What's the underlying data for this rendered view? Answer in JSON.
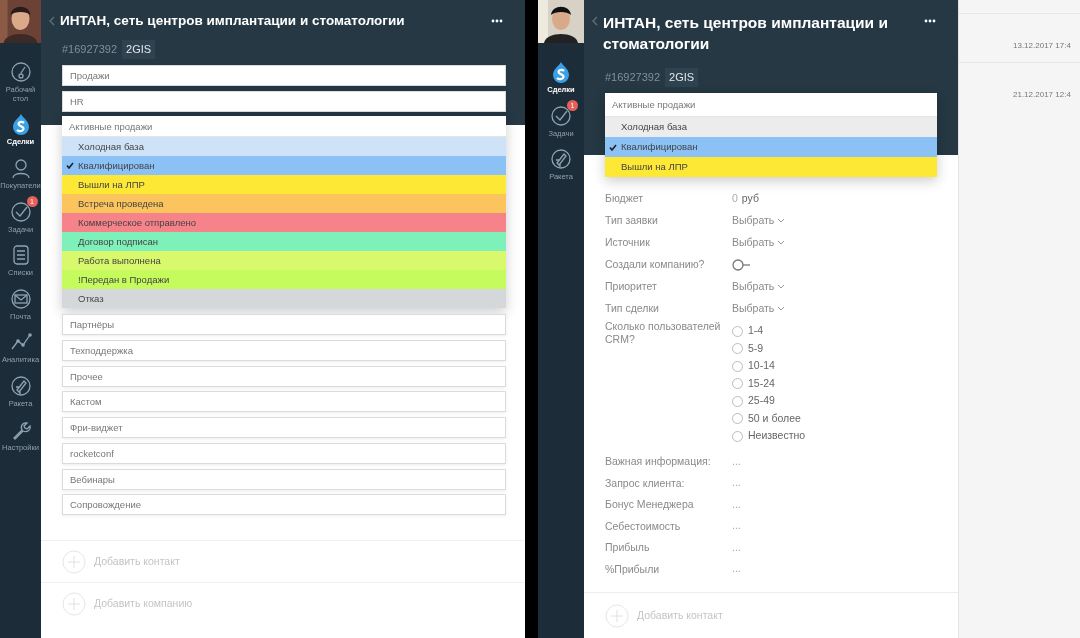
{
  "panels": [
    {
      "sidebar": {
        "items": [
          {
            "kind": "gauge",
            "label": "Рабочий стол",
            "selected": false
          },
          {
            "kind": "deals",
            "label": "Сделки",
            "selected": true
          },
          {
            "kind": "person",
            "label": "Покупатели",
            "selected": false
          },
          {
            "kind": "check",
            "label": "Задачи",
            "selected": false,
            "badge": "1"
          },
          {
            "kind": "list",
            "label": "Списки",
            "selected": false
          },
          {
            "kind": "mail",
            "label": "Почта",
            "selected": false
          },
          {
            "kind": "chart",
            "label": "Аналитика",
            "selected": false
          },
          {
            "kind": "rocket",
            "label": "Ракета",
            "selected": false
          },
          {
            "kind": "wrench",
            "label": "Настройки",
            "selected": false
          }
        ]
      },
      "header": {
        "title": "ИНТАН, сеть центров имплантации и стоматологии",
        "id": "#16927392",
        "tag": "2GIS"
      },
      "pipelines": [
        {
          "label": "Продажи",
          "expanded": false
        },
        {
          "label": "HR",
          "expanded": false
        },
        {
          "label": "Активные продажи",
          "expanded": true,
          "stages": [
            {
              "label": "Холодная база",
              "color": "#cfe3f8",
              "selected": false
            },
            {
              "label": "Квалифицирован",
              "color": "#8bc1f5",
              "selected": true
            },
            {
              "label": "Вышли на ЛПР",
              "color": "#fde835",
              "selected": false
            },
            {
              "label": "Встреча проведена",
              "color": "#fbc45c",
              "selected": false
            },
            {
              "label": "Коммерческое отправлено",
              "color": "#f6828a",
              "selected": false
            },
            {
              "label": "Договор подписан",
              "color": "#7ef0b9",
              "selected": false
            },
            {
              "label": "Работа выполнена",
              "color": "#d7f96b",
              "selected": false
            },
            {
              "label": "!Передан в Продажи",
              "color": "#c6fb5e",
              "selected": false
            },
            {
              "label": "Отказ",
              "color": "#d5d8db",
              "selected": false
            }
          ]
        },
        {
          "label": "Партнёры",
          "expanded": false
        },
        {
          "label": "Техподдержка",
          "expanded": false
        },
        {
          "label": "Прочее",
          "expanded": false
        },
        {
          "label": "Кастом",
          "expanded": false
        },
        {
          "label": "Фри-виджет",
          "expanded": false
        },
        {
          "label": "rocketconf",
          "expanded": false
        },
        {
          "label": "Вебинары",
          "expanded": false
        },
        {
          "label": "Сопровождение",
          "expanded": false
        }
      ],
      "actions": [
        {
          "label": "Добавить контакт"
        },
        {
          "label": "Добавить компанию"
        }
      ]
    },
    {
      "sidebar": {
        "items": [
          {
            "kind": "deals",
            "label": "Сделки",
            "selected": true
          },
          {
            "kind": "check",
            "label": "Задачи",
            "selected": false,
            "badge": "1"
          },
          {
            "kind": "rocket",
            "label": "Ракета",
            "selected": false
          }
        ]
      },
      "header": {
        "title": "ИНТАН, сеть центров имплантации и стоматологии",
        "id": "#16927392",
        "tag": "2GIS"
      },
      "pipelines": [
        {
          "label": "Активные продажи",
          "expanded": true,
          "stages": [
            {
              "label": "Холодная база",
              "color": "#ececec",
              "selected": false
            },
            {
              "label": "Квалифицирован",
              "color": "#8bc1f5",
              "selected": true
            },
            {
              "label": "Вышли на ЛПР",
              "color": "#fde835",
              "selected": false
            }
          ]
        }
      ],
      "fields": [
        {
          "label": "Бюджет",
          "kind": "money",
          "value": "0",
          "unit": "руб"
        },
        {
          "label": "Тип заявки",
          "kind": "select",
          "value": "Выбрать"
        },
        {
          "label": "Источник",
          "kind": "select",
          "value": "Выбрать"
        },
        {
          "label": "Создали компанию?",
          "kind": "toggle",
          "on": false
        },
        {
          "label": "Приоритет",
          "kind": "select",
          "value": "Выбрать"
        },
        {
          "label": "Тип сделки",
          "kind": "select",
          "value": "Выбрать"
        },
        {
          "label": "Сколько пользователей CRM?",
          "kind": "radio",
          "options": [
            {
              "label": "1-4",
              "selected": false
            },
            {
              "label": "5-9",
              "selected": false
            },
            {
              "label": "10-14",
              "selected": false
            },
            {
              "label": "15-24",
              "selected": false
            },
            {
              "label": "25-49",
              "selected": false
            },
            {
              "label": "50 и более",
              "selected": false
            },
            {
              "label": "Неизвестно",
              "selected": false
            }
          ]
        },
        {
          "label": "Важная информация:",
          "kind": "text",
          "value": "..."
        },
        {
          "label": "Запрос клиента:",
          "kind": "text",
          "value": "..."
        },
        {
          "label": "Бонус Менеджера",
          "kind": "text",
          "value": "..."
        },
        {
          "label": "Себестоимость",
          "kind": "text",
          "value": "..."
        },
        {
          "label": "Прибыль",
          "kind": "text",
          "value": "..."
        },
        {
          "label": "%Прибыли",
          "kind": "text",
          "value": "..."
        }
      ],
      "actions": [
        {
          "label": "Добавить контакт"
        }
      ],
      "feed": [
        {
          "date": "13.12.2017 17:4"
        },
        {
          "date": "21.12.2017 12:4"
        }
      ]
    }
  ]
}
